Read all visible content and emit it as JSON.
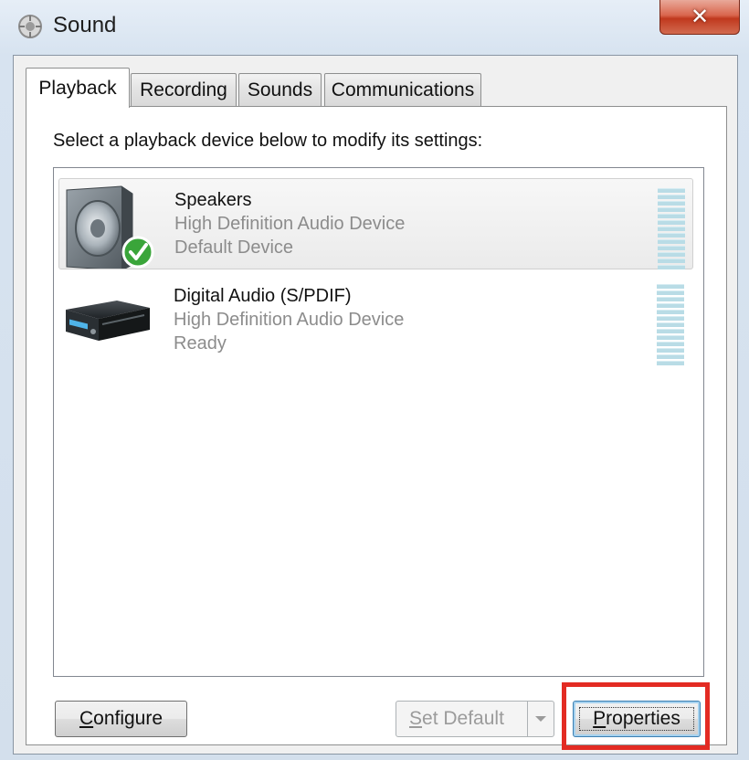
{
  "window": {
    "title": "Sound",
    "close_glyph": "✕"
  },
  "tabs": [
    {
      "label": "Playback",
      "active": true
    },
    {
      "label": "Recording",
      "active": false
    },
    {
      "label": "Sounds",
      "active": false
    },
    {
      "label": "Communications",
      "active": false
    }
  ],
  "playback": {
    "instruction": "Select a playback device below to modify its settings:",
    "devices": [
      {
        "name": "Speakers",
        "driver": "High Definition Audio Device",
        "status": "Default Device",
        "icon": "speaker-icon",
        "badge": "default-check-icon",
        "selected": true
      },
      {
        "name": "Digital Audio (S/PDIF)",
        "driver": "High Definition Audio Device",
        "status": "Ready",
        "icon": "digital-audio-receiver-icon",
        "selected": false
      }
    ]
  },
  "buttons": {
    "configure_prefix": "",
    "configure_mnemonic": "C",
    "configure_rest": "onfigure",
    "set_default_mnemonic": "S",
    "set_default_rest": "et Default",
    "properties_mnemonic": "P",
    "properties_rest": "roperties"
  },
  "colors": {
    "highlight": "#e32b23",
    "check_green": "#3aa53a",
    "meter": "#b9dce6"
  }
}
